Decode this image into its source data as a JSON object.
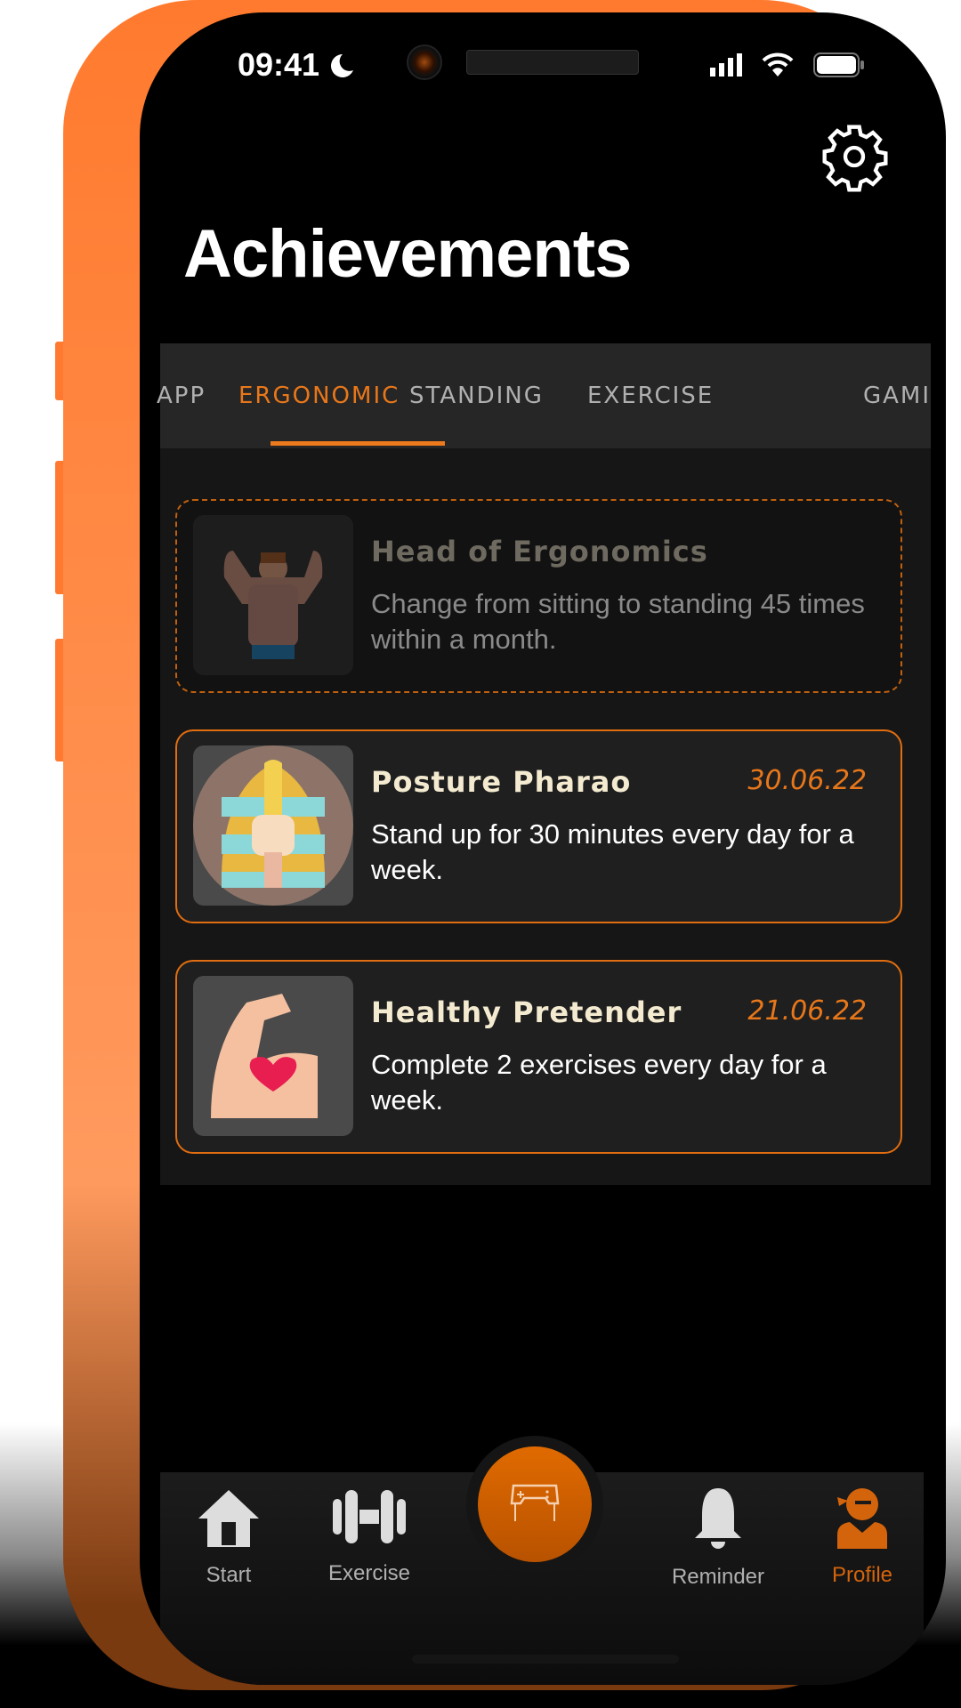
{
  "status_bar": {
    "time": "09:41"
  },
  "header": {
    "title": "Achievements"
  },
  "tabs": [
    {
      "label": "APP"
    },
    {
      "label": "ERGONOMIC",
      "active": true
    },
    {
      "label": "STANDING"
    },
    {
      "label": "EXERCISE"
    },
    {
      "label": "GAMI"
    }
  ],
  "achievements": [
    {
      "title": "Head of Ergonomics",
      "description": "Change from sitting to standing 45 times within a month.",
      "date": "",
      "locked": true,
      "icon": "bodybuilder-icon"
    },
    {
      "title": "Posture Pharao",
      "description": "Stand up for 30 minutes every day for a week.",
      "date": "30.06.22",
      "locked": false,
      "icon": "pharaoh-icon"
    },
    {
      "title": "Healthy Pretender",
      "description": "Complete 2 exercises every day for a week.",
      "date": "21.06.22",
      "locked": false,
      "icon": "flexed-arm-heart-icon"
    }
  ],
  "nav": [
    {
      "label": "Start",
      "icon": "home-icon"
    },
    {
      "label": "Exercise",
      "icon": "dumbbell-icon"
    },
    {
      "label": "",
      "icon": "gamepad-icon"
    },
    {
      "label": "Reminder",
      "icon": "bell-icon"
    },
    {
      "label": "Profile",
      "icon": "ninja-user-icon",
      "active": true
    }
  ],
  "colors": {
    "accent": "#e8771a",
    "frame": "#ff7a2e",
    "background": "#000000"
  }
}
